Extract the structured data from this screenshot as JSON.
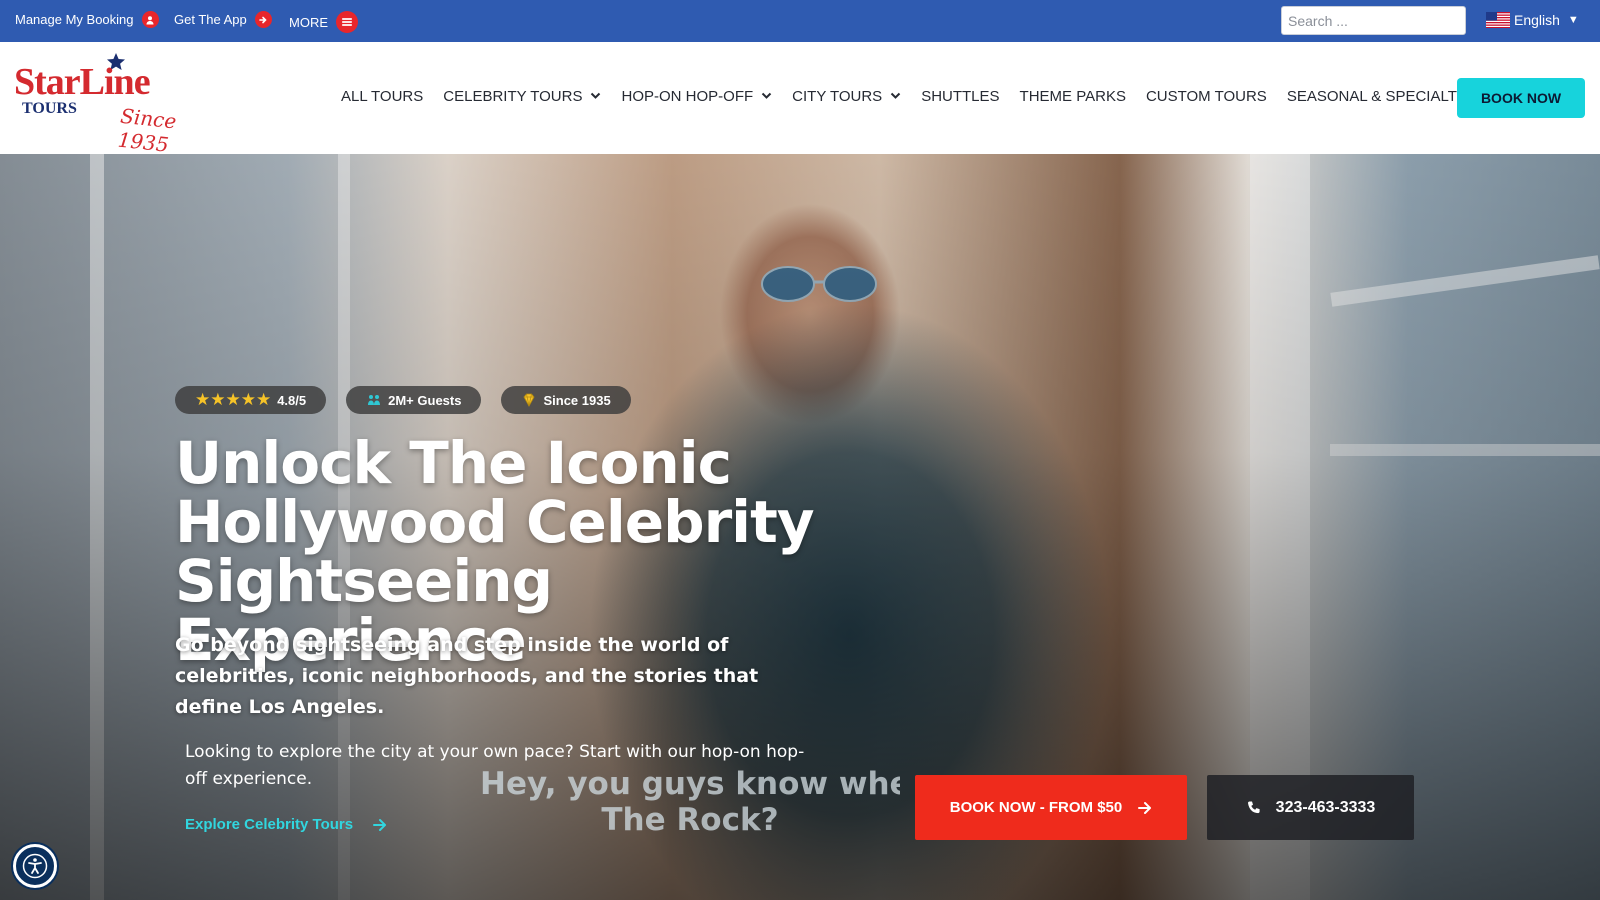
{
  "topbar": {
    "manage_booking": "Manage My Booking",
    "get_app": "Get The App",
    "more": "MORE",
    "search_placeholder": "Search ...",
    "language": "English"
  },
  "header": {
    "logo": {
      "brand": "StarLine",
      "sub": "TOURS",
      "since": "Since 1935"
    },
    "nav": [
      {
        "label": "ALL TOURS",
        "dropdown": false
      },
      {
        "label": "CELEBRITY TOURS",
        "dropdown": true
      },
      {
        "label": "HOP-ON HOP-OFF",
        "dropdown": true
      },
      {
        "label": "CITY TOURS",
        "dropdown": true
      },
      {
        "label": "SHUTTLES",
        "dropdown": false
      },
      {
        "label": "THEME PARKS",
        "dropdown": false
      },
      {
        "label": "CUSTOM TOURS",
        "dropdown": false
      },
      {
        "label": "SEASONAL & SPECIALTY TOURS",
        "dropdown": false
      }
    ],
    "book_now": "BOOK NOW"
  },
  "hero": {
    "rating_stars": "★★★★★",
    "rating": "4.8/5",
    "guests": "2M+ Guests",
    "since": "Since 1935",
    "title": "Unlock The Iconic Hollywood Celebrity Sightseeing Experience",
    "subtitle": "Go beyond sightseeing and step inside the world of celebrities, iconic neighborhoods, and the stories that define Los Angeles.",
    "note": "Looking to explore the city at your own pace? Start with our hop-on hop-off experience.",
    "explore_link": "Explore Celebrity Tours",
    "caption_line1": "Hey, you guys know wher",
    "caption_line2": "The Rock?",
    "cta_book": "BOOK NOW - FROM $50",
    "cta_phone": "323-463-3333"
  },
  "colors": {
    "topbar": "#2f5bb1",
    "accent_cyan": "#17d3dc",
    "cta_red": "#ef2b1c",
    "logo_red": "#d42a2f",
    "logo_navy": "#1b2f70",
    "star_gold": "#f6c328"
  },
  "icons": {
    "manage_booking": "user-icon",
    "get_app": "arrow-right-icon",
    "more": "hamburger-menu-icon",
    "language": "us-flag-icon",
    "guests": "people-icon",
    "since": "diamond-icon",
    "phone": "phone-icon",
    "accessibility": "accessibility-icon"
  }
}
